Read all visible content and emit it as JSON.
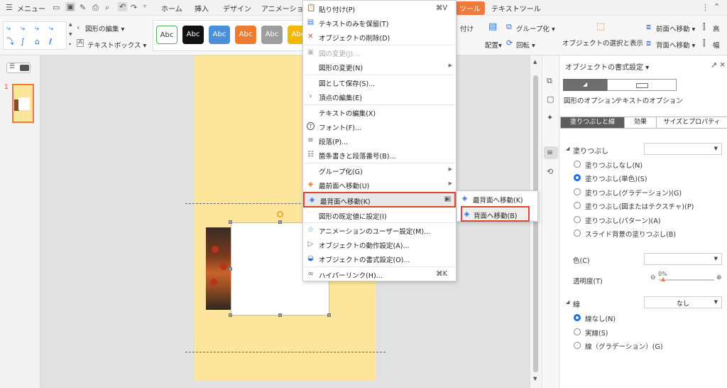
{
  "topbar": {
    "menu_label": "メニュー",
    "tabs": [
      "ホーム",
      "挿入",
      "デザイン",
      "アニメーショ"
    ],
    "active_tab": "ツール",
    "text_tool_tab": "テキストツール"
  },
  "ribbon": {
    "edit_shape": "図形の編集",
    "textbox": "テキストボックス",
    "style_labels": [
      "Abc",
      "Abc",
      "Abc",
      "Abc",
      "Abc",
      "Abc"
    ],
    "paste_fragment": "付け",
    "arrange": "配置",
    "group": "グループ化",
    "rotate": "回転",
    "select_pane": "オブジェクトの選択と表示",
    "bring_forward": "前面へ移動",
    "send_backward": "背面へ移動",
    "height_fragment": "高",
    "width_fragment": "幅"
  },
  "slides": {
    "numbers": [
      "1"
    ]
  },
  "context_menu": {
    "items": [
      {
        "label": "貼り付け(P)",
        "shortcut": "⌘V",
        "icon": "paste-icon"
      },
      {
        "label": "テキストのみを保留(T)",
        "icon": "keep-text-icon"
      },
      {
        "label": "オブジェクトの削除(D)",
        "icon": "delete-icon"
      },
      {
        "label": "図の変更(J)...",
        "icon": "change-picture-icon",
        "disabled": true
      },
      {
        "label": "図形の変更(N)",
        "submenu": true
      },
      {
        "label": "図として保存(S)..."
      },
      {
        "label": "頂点の編集(E)",
        "icon": "edit-points-icon"
      },
      {
        "label": "テキストの編集(X)"
      },
      {
        "label": "フォント(F)...",
        "icon": "font-icon"
      },
      {
        "label": "段落(P)...",
        "icon": "paragraph-icon"
      },
      {
        "label": "箇条書きと段落番号(B)...",
        "icon": "bullets-icon"
      },
      {
        "label": "グループ化(G)",
        "submenu": true
      },
      {
        "label": "最前面へ移動(U)",
        "icon": "bring-front-icon",
        "submenu": true
      },
      {
        "label": "最背面へ移動(K)",
        "icon": "send-back-icon",
        "submenu": true,
        "highlighted": true
      },
      {
        "label": "図形の既定値に設定(I)"
      },
      {
        "label": "アニメーションのユーザー設定(M)...",
        "icon": "animation-icon"
      },
      {
        "label": "オブジェクトの動作設定(A)...",
        "icon": "action-icon"
      },
      {
        "label": "オブジェクトの書式設定(O)...",
        "icon": "format-icon"
      },
      {
        "label": "ハイパーリンク(H)...",
        "shortcut": "⌘K",
        "icon": "hyperlink-icon"
      }
    ]
  },
  "submenu": {
    "items": [
      {
        "label": "最背面へ移動(K)"
      },
      {
        "label": "背面へ移動(B)",
        "highlighted": true
      }
    ]
  },
  "panel": {
    "title": "オブジェクトの書式設定",
    "shape_options": "図形のオプション",
    "text_options": "テキストのオプション",
    "tabs": [
      "塗りつぶしと線",
      "効果",
      "サイズとプロパティ"
    ],
    "fill_section": "塗りつぶし",
    "fill_options": [
      "塗りつぶしなし(N)",
      "塗りつぶし(単色)(S)",
      "塗りつぶし(グラデーション)(G)",
      "塗りつぶし(図またはテクスチャ)(P)",
      "塗りつぶし(パターン)(A)",
      "スライド背景の塗りつぶし(B)"
    ],
    "fill_selected_index": 1,
    "color_label": "色(C)",
    "transparency_label": "透明度(T)",
    "transparency_value": "0%",
    "line_section": "線",
    "line_value": "なし",
    "line_options": [
      "線なし(N)",
      "実線(S)",
      "線（グラデーション）(G)"
    ],
    "line_selected_index": 0
  },
  "colors": {
    "accent": "#1a6fe8",
    "highlight_border": "#e0462f",
    "active_tab": "#f07a3c",
    "slide_bg": "#fde59c"
  }
}
